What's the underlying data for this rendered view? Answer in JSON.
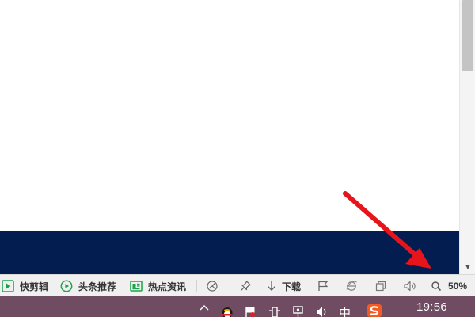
{
  "status_bar": {
    "kuaijianji_label": "快剪辑",
    "toutiao_label": "头条推荐",
    "redian_label": "热点资讯",
    "download_label": "下载",
    "zoom_level": "50%"
  },
  "taskbar": {
    "clock": "19:56",
    "ime_label": "中"
  },
  "colors": {
    "dark_band": "#031d50",
    "taskbar": "#6f4c62",
    "status_green": "#1aa34a",
    "annotation_arrow": "#e8141b"
  }
}
